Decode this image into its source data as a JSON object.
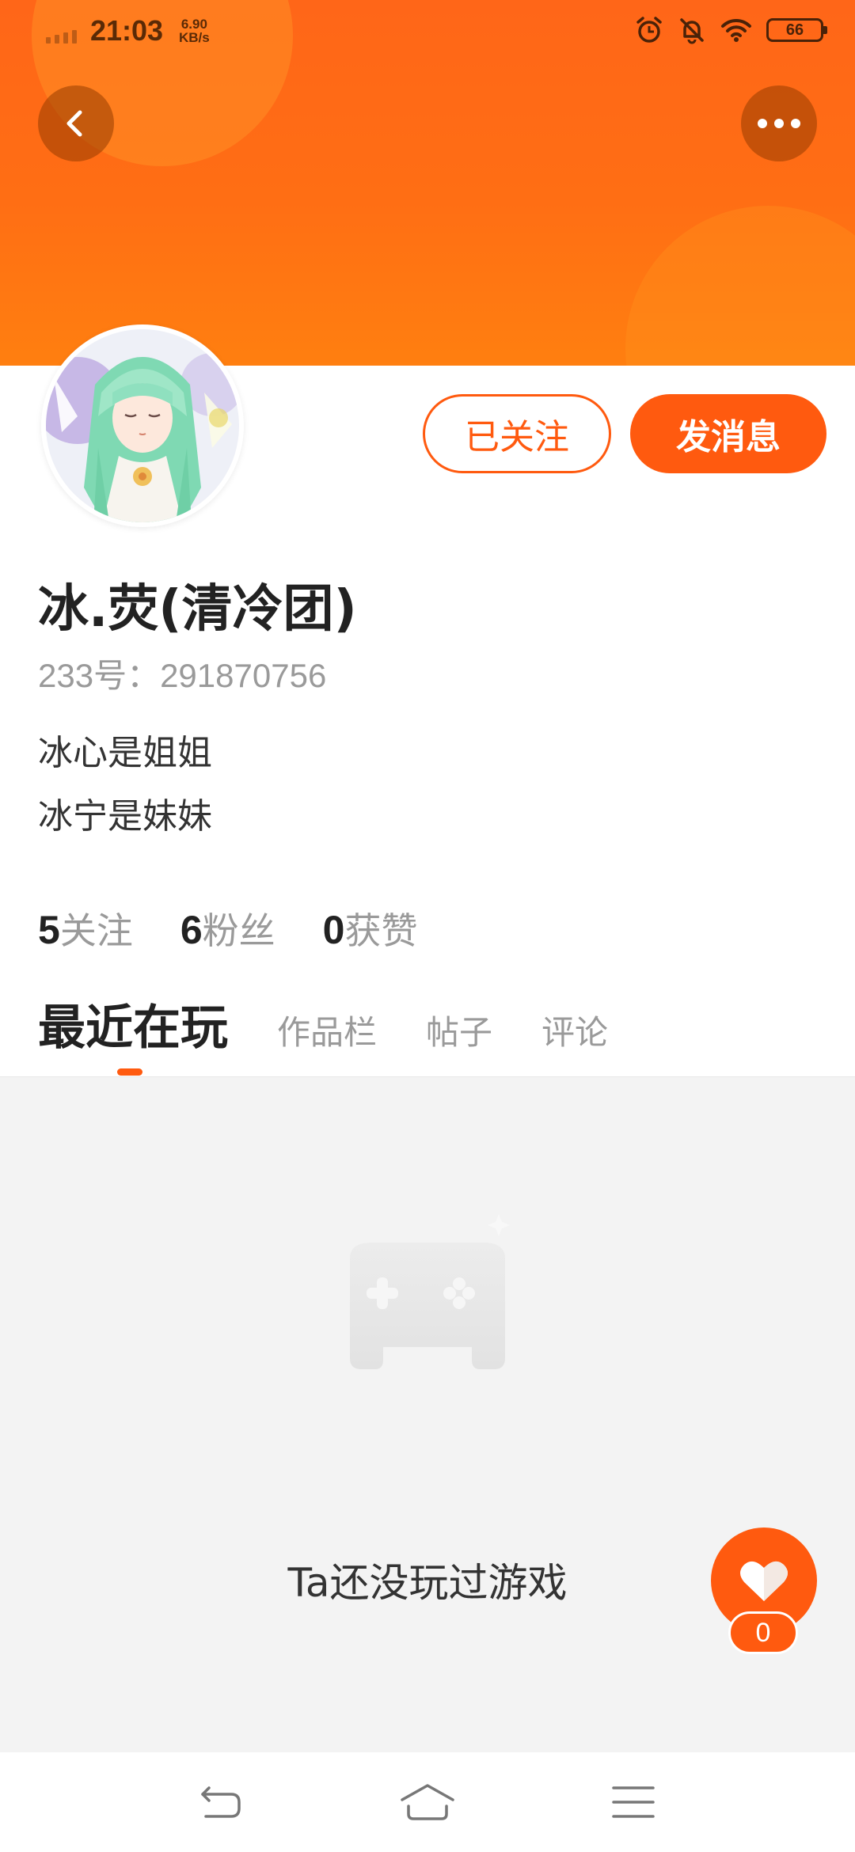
{
  "status_bar": {
    "time": "21:03",
    "net_speed_value": "6.90",
    "net_speed_unit": "KB/s",
    "battery": "66",
    "icons": [
      "alarm-icon",
      "bell-off-icon",
      "wifi-icon",
      "battery-icon"
    ]
  },
  "header": {
    "back_icon": "chevron-left-icon",
    "more_icon": "more-dots-icon"
  },
  "profile": {
    "followed_label": "已关注",
    "message_label": "发消息",
    "nickname": "冰.荧(清冷团)",
    "uid_text": "233号：291870756",
    "bio_lines": [
      "冰心是姐姐",
      "冰宁是妹妹"
    ]
  },
  "stats": {
    "following_count": "5",
    "following_label": "关注",
    "fans_count": "6",
    "fans_label": "粉丝",
    "likes_count": "0",
    "likes_label": "获赞"
  },
  "tabs": {
    "recent": "最近在玩",
    "works": "作品栏",
    "posts": "帖子",
    "comments": "评论"
  },
  "empty_state": {
    "icon": "gamepad-icon",
    "text": "Ta还没玩过游戏"
  },
  "like_button": {
    "icon": "heart-icon",
    "count": "0"
  },
  "nav_bar": {
    "icons": [
      "nav-back-icon",
      "nav-home-icon",
      "nav-menu-icon"
    ]
  },
  "colors": {
    "accent": "#FF5A0F",
    "banner": "#FF6E14"
  }
}
